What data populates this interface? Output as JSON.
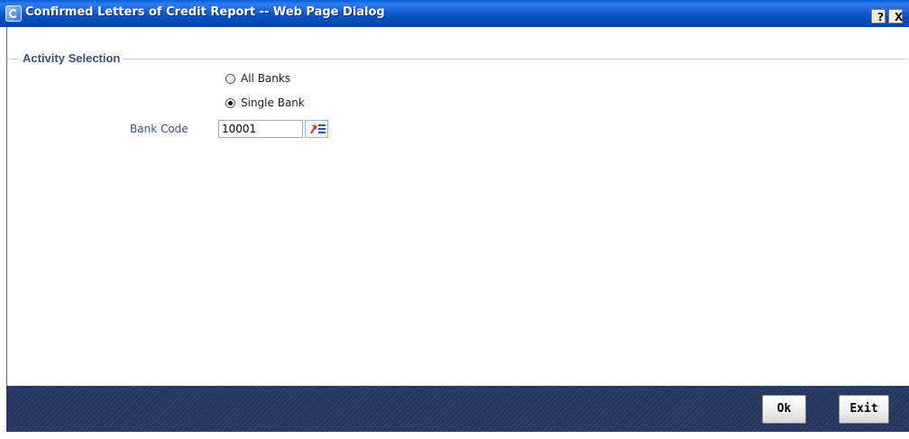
{
  "window": {
    "title": "Confirmed Letters of Credit Report -- Web Page Dialog",
    "help_label": "?",
    "close_label": "X"
  },
  "activity_selection": {
    "legend": "Activity Selection",
    "options": [
      {
        "label": "All Banks",
        "selected": false
      },
      {
        "label": "Single Bank",
        "selected": true
      }
    ],
    "bank_code": {
      "label": "Bank Code",
      "value": "10001"
    }
  },
  "footer": {
    "ok_label": "Ok",
    "exit_label": "Exit"
  },
  "colors": {
    "titlebar": "#0a55c8",
    "footer": "#26375f",
    "legend_text": "#3b4f7e",
    "field_label": "#3e4f8c",
    "lov_arrow": "#e0302a"
  }
}
